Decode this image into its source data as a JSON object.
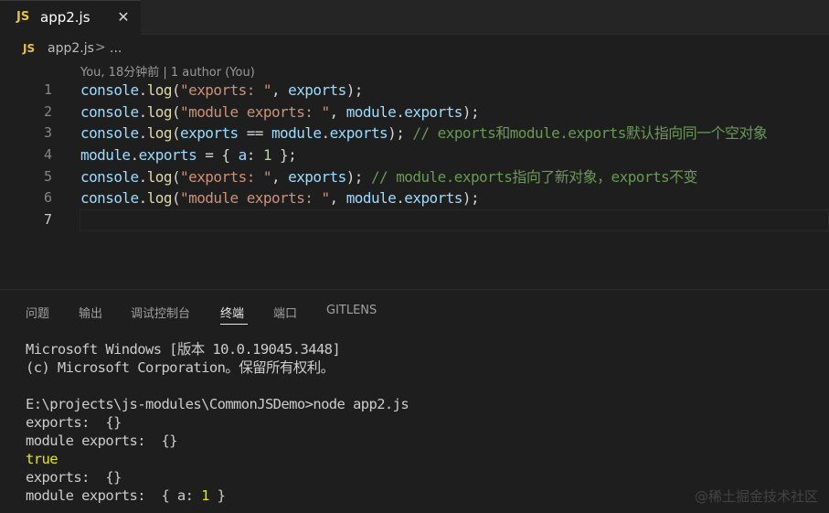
{
  "tab": {
    "icon_text": "JS",
    "title": "app2.js",
    "close_glyph": "✕"
  },
  "breadcrumb": {
    "icon_text": "JS",
    "file": "app2.js",
    "separator": ">",
    "more": "..."
  },
  "codelens": "You, 18分钟前 | 1 author (You)",
  "editor": {
    "line_numbers": [
      "1",
      "2",
      "3",
      "4",
      "5",
      "6",
      "7"
    ],
    "lines": [
      [
        [
          "t-var",
          "console"
        ],
        [
          "",
          "."
        ],
        [
          "t-fn",
          "log"
        ],
        [
          "",
          "("
        ],
        [
          "t-str",
          "\"exports: \""
        ],
        [
          "",
          ", "
        ],
        [
          "t-var",
          "exports"
        ],
        [
          "",
          ");"
        ]
      ],
      [
        [
          "t-var",
          "console"
        ],
        [
          "",
          "."
        ],
        [
          "t-fn",
          "log"
        ],
        [
          "",
          "("
        ],
        [
          "t-str",
          "\"module exports: \""
        ],
        [
          "",
          ", "
        ],
        [
          "t-var",
          "module"
        ],
        [
          "",
          "."
        ],
        [
          "t-var",
          "exports"
        ],
        [
          "",
          ");"
        ]
      ],
      [
        [
          "t-var",
          "console"
        ],
        [
          "",
          "."
        ],
        [
          "t-fn",
          "log"
        ],
        [
          "",
          "("
        ],
        [
          "t-var",
          "exports"
        ],
        [
          "",
          " == "
        ],
        [
          "t-var",
          "module"
        ],
        [
          "",
          "."
        ],
        [
          "t-var",
          "exports"
        ],
        [
          "",
          ");"
        ],
        [
          "t-com",
          " // exports和module.exports默认指向同一个空对象"
        ]
      ],
      [
        [
          "t-var",
          "module"
        ],
        [
          "",
          "."
        ],
        [
          "t-var",
          "exports"
        ],
        [
          "",
          " = { "
        ],
        [
          "t-var",
          "a"
        ],
        [
          "",
          ": "
        ],
        [
          "t-num",
          "1"
        ],
        [
          "",
          " };"
        ]
      ],
      [
        [
          "t-var",
          "console"
        ],
        [
          "",
          "."
        ],
        [
          "t-fn",
          "log"
        ],
        [
          "",
          "("
        ],
        [
          "t-str",
          "\"exports: \""
        ],
        [
          "",
          ", "
        ],
        [
          "t-var",
          "exports"
        ],
        [
          "",
          ");"
        ],
        [
          "t-com",
          " // module.exports指向了新对象，exports不变"
        ]
      ],
      [
        [
          "t-var",
          "console"
        ],
        [
          "",
          "."
        ],
        [
          "t-fn",
          "log"
        ],
        [
          "",
          "("
        ],
        [
          "t-str",
          "\"module exports: \""
        ],
        [
          "",
          ", "
        ],
        [
          "t-var",
          "module"
        ],
        [
          "",
          "."
        ],
        [
          "t-var",
          "exports"
        ],
        [
          "",
          ");"
        ]
      ],
      []
    ]
  },
  "panel": {
    "tabs": [
      "问题",
      "输出",
      "调试控制台",
      "终端",
      "端口",
      "GITLENS"
    ],
    "active_tab": "终端"
  },
  "terminal": {
    "lines": [
      [
        [
          "",
          "Microsoft Windows [版本 10.0.19045.3448]"
        ]
      ],
      [
        [
          "",
          "(c) Microsoft Corporation。保留所有权利。"
        ]
      ],
      [
        [
          "",
          ""
        ]
      ],
      [
        [
          "",
          "E:\\projects\\js-modules\\CommonJSDemo>node app2.js"
        ]
      ],
      [
        [
          "",
          "exports:  {}"
        ]
      ],
      [
        [
          "",
          "module exports:  {}"
        ]
      ],
      [
        [
          "term-yellow",
          "true"
        ]
      ],
      [
        [
          "",
          "exports:  {}"
        ]
      ],
      [
        [
          "",
          "module exports:  { a: "
        ],
        [
          "term-yellow",
          "1"
        ],
        [
          "",
          " }"
        ]
      ]
    ]
  },
  "watermark": "@稀土掘金技术社区",
  "colors": {
    "background": "#1e1e1e",
    "js_icon": "#e5c143",
    "variable": "#9cdcfe",
    "function": "#dcdcaa",
    "string": "#ce9178",
    "number": "#b5cea8",
    "comment": "#6a9955"
  }
}
